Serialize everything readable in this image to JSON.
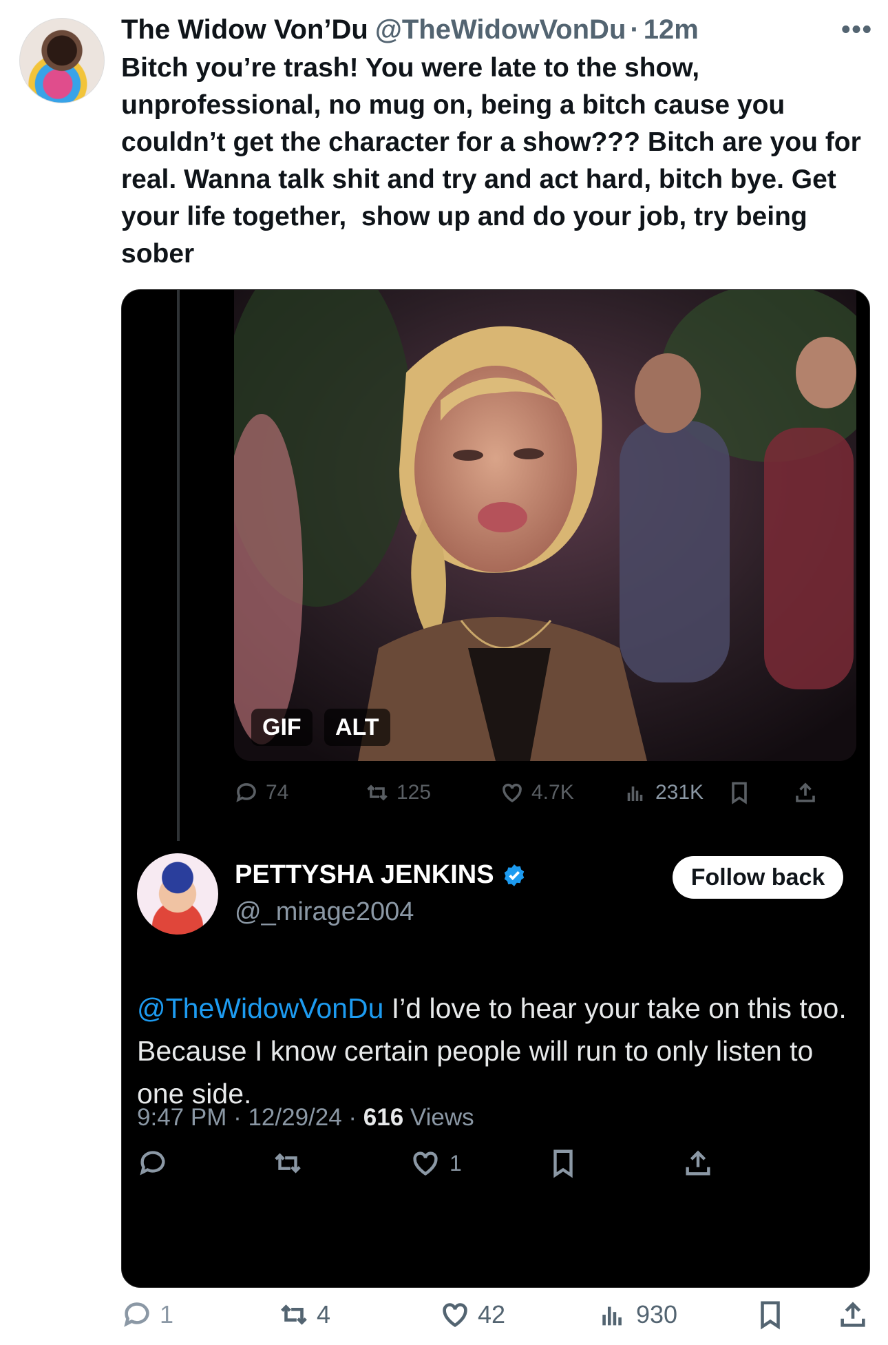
{
  "tweet": {
    "author_name": "The Widow Von’Du",
    "author_handle": "@TheWidowVonDu",
    "separator": "·",
    "time": "12m",
    "more": "•••",
    "text": "Bitch you’re trash! You were late to the show, unprofessional, no mug on, being a bitch cause you couldn’t get the character for a show??? Bitch are you for real. Wanna talk shit and try and act hard, bitch bye. Get your life together,  show up and do your job, try being sober",
    "replies": "1",
    "retweets": "4",
    "likes": "42",
    "views": "930"
  },
  "embed": {
    "media": {
      "gif_label": "GIF",
      "alt_label": "ALT"
    },
    "faded_stats": {
      "replies": "74",
      "retweets": "125",
      "likes": "4.7K",
      "views": "231K"
    },
    "quoted": {
      "name": "PETTYSHA JENKINS",
      "handle": "@_mirage2004",
      "follow_label": "Follow back",
      "mention": "@TheWidowVonDu",
      "text": " I’d love to hear your take on this too. Because I know certain people will run to only listen to one side.",
      "meta_prefix": "9:47 PM · 12/29/24 · ",
      "views_num": "616",
      "views_label": " Views",
      "likes": "1"
    }
  },
  "colors": {
    "accent": "#1d9bf0",
    "secondary_text": "#536471"
  }
}
